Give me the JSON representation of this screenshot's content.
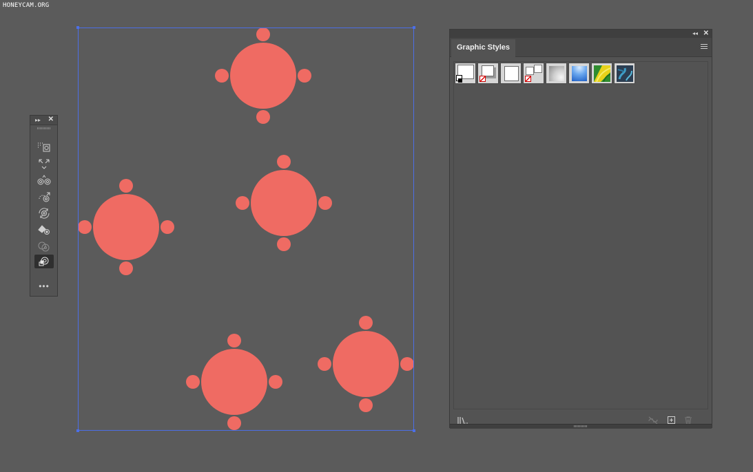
{
  "watermark": "HONEYCAM.ORG",
  "tools_panel": {
    "collapse_glyph": "▸▸",
    "close_glyph": "✕",
    "more_glyph": "•••",
    "tools": [
      {
        "icon": "transparency-options-icon"
      },
      {
        "icon": "scale-selection-icon"
      },
      {
        "icon": "blend-objects-icon"
      },
      {
        "icon": "move-pattern-icon"
      },
      {
        "icon": "rotate-object-icon"
      },
      {
        "icon": "paint-bucket-icon"
      },
      {
        "icon": "blend-mode-icon"
      },
      {
        "icon": "graphic-styles-tool-icon",
        "active": true
      }
    ]
  },
  "graphic_styles_panel": {
    "title": "Graphic Styles",
    "collapse_glyph": "◂◂",
    "close_glyph": "✕",
    "swatches": [
      {
        "name": "default-graphic-style-swatch"
      },
      {
        "name": "drop-shadow-style-swatch"
      },
      {
        "name": "plain-white-style-swatch"
      },
      {
        "name": "split-style-swatch"
      },
      {
        "name": "grey-gradient-style-swatch"
      },
      {
        "name": "blue-gradient-style-swatch"
      },
      {
        "name": "green-texture-style-swatch"
      },
      {
        "name": "teal-texture-style-swatch"
      }
    ],
    "footer_icons": [
      "graphic-styles-library-icon",
      "break-link-icon",
      "new-graphic-style-icon",
      "delete-style-icon"
    ]
  },
  "colors": {
    "canvas_background": "#5b5b5b",
    "shape_fill": "#ef6b63",
    "selection": "#4c6fe8",
    "panel_background": "#535353"
  },
  "artwork": {
    "description_visible": false,
    "table_groups": 5,
    "chairs_per_table": 4
  }
}
